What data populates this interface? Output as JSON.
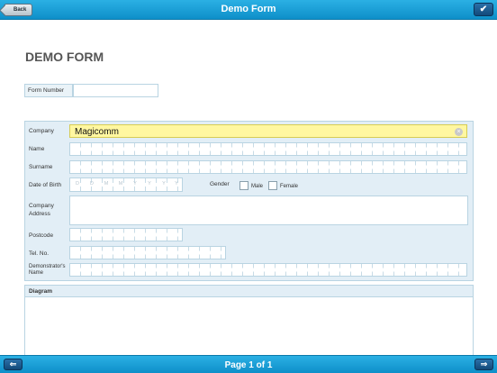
{
  "topbar": {
    "back_label": "Back",
    "title": "Demo Form",
    "check_icon": "✔"
  },
  "page_title": "DEMO FORM",
  "form_number": {
    "label": "Form Number",
    "value": ""
  },
  "fields": {
    "company": {
      "label": "Company",
      "value": "Magicomm"
    },
    "name": {
      "label": "Name",
      "value": ""
    },
    "surname": {
      "label": "Surname",
      "value": ""
    },
    "dob": {
      "label": "Date of Birth",
      "placeholders": [
        "D",
        "D",
        "M",
        "M",
        "Y",
        "Y",
        "Y",
        "Y"
      ]
    },
    "gender": {
      "label": "Gender",
      "options": [
        "Male",
        "Female"
      ]
    },
    "address": {
      "label_line1": "Company",
      "label_line2": "Address",
      "value": ""
    },
    "postcode": {
      "label": "Postcode",
      "value": ""
    },
    "tel": {
      "label": "Tel. No.",
      "value": ""
    },
    "demonstrator": {
      "label_line1": "Demonstrator's",
      "label_line2": "Name",
      "value": ""
    }
  },
  "diagram": {
    "label": "Diagram"
  },
  "bottombar": {
    "page_info": "Page 1 of 1",
    "prev_icon": "⇐",
    "next_icon": "⇒"
  },
  "colors": {
    "bar": "#0e8fc9",
    "panel": "#e2eef6",
    "highlight": "#fff7a0"
  }
}
